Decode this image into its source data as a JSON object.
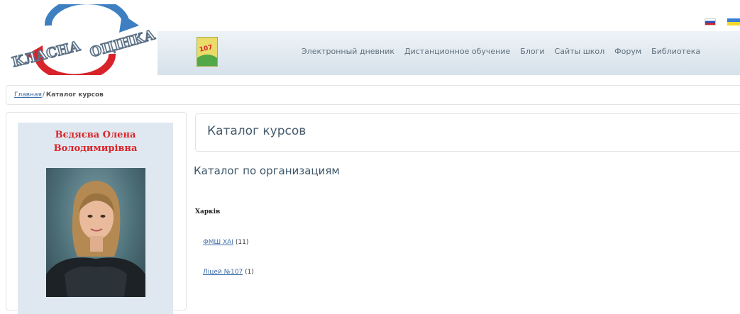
{
  "logo": {
    "text_left": "КЛАСНА",
    "text_right": "ОЦІНКА"
  },
  "school_badge": {
    "number": "107"
  },
  "nav": [
    "Электронный дневник",
    "Дистанционное обучение",
    "Блоги",
    "Сайты школ",
    "Форум",
    "Библиотека"
  ],
  "languages": [
    "ru-flag",
    "ua-flag"
  ],
  "breadcrumb": {
    "home": "Главная",
    "separator": "/",
    "current": "Каталог курсов"
  },
  "profile": {
    "name": "Вєдяєва Олена Володимирівна"
  },
  "main": {
    "page_title": "Каталог курсов",
    "section_title": "Каталог по организациям",
    "city": "Харків",
    "organizations": [
      {
        "name": "ФМШ ХАІ",
        "count": "(11)"
      },
      {
        "name": "Ліцей №107",
        "count": "(1)"
      }
    ]
  },
  "colors": {
    "accent": "#d9262c",
    "link": "#3d6eaa",
    "card": "#dfe8f0"
  }
}
